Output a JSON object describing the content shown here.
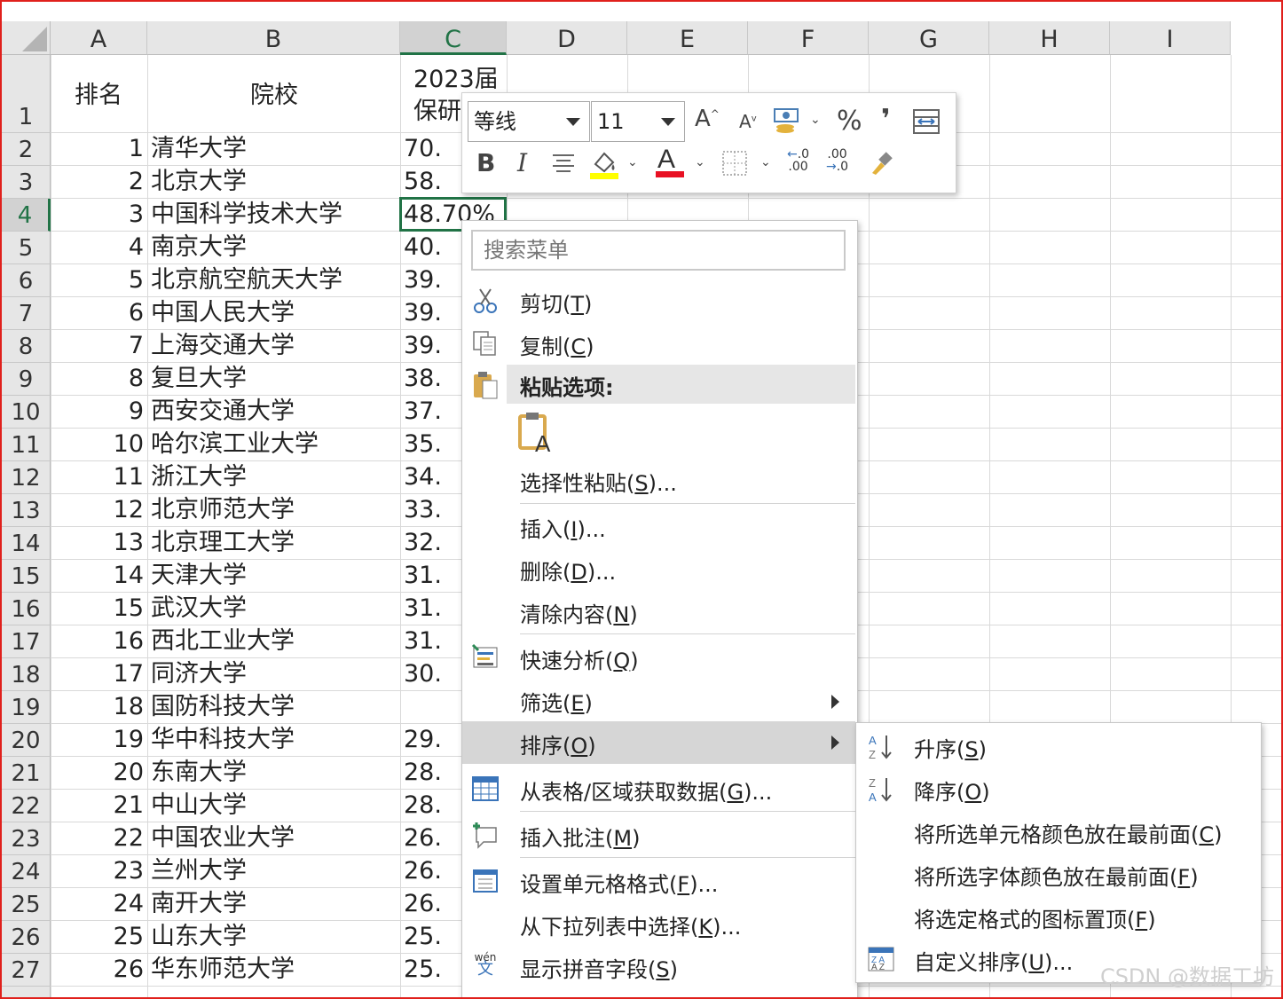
{
  "columns": [
    "A",
    "B",
    "C",
    "D",
    "E",
    "F",
    "G",
    "H",
    "I"
  ],
  "selected_column": "C",
  "selected_row": "4",
  "header_row": {
    "rank": "排名",
    "school": "院校",
    "c_line1": "2023届",
    "c_line2": "保研"
  },
  "rows": [
    {
      "row": "2",
      "rank": "1",
      "school": "清华大学",
      "c": "70."
    },
    {
      "row": "3",
      "rank": "2",
      "school": "北京大学",
      "c": "58."
    },
    {
      "row": "4",
      "rank": "3",
      "school": "中国科学技术大学",
      "c": "48.70%"
    },
    {
      "row": "5",
      "rank": "4",
      "school": "南京大学",
      "c": "40."
    },
    {
      "row": "6",
      "rank": "5",
      "school": "北京航空航天大学",
      "c": "39."
    },
    {
      "row": "7",
      "rank": "6",
      "school": "中国人民大学",
      "c": "39."
    },
    {
      "row": "8",
      "rank": "7",
      "school": "上海交通大学",
      "c": "39."
    },
    {
      "row": "9",
      "rank": "8",
      "school": "复旦大学",
      "c": "38."
    },
    {
      "row": "10",
      "rank": "9",
      "school": "西安交通大学",
      "c": "37."
    },
    {
      "row": "11",
      "rank": "10",
      "school": "哈尔滨工业大学",
      "c": "35."
    },
    {
      "row": "12",
      "rank": "11",
      "school": "浙江大学",
      "c": "34."
    },
    {
      "row": "13",
      "rank": "12",
      "school": "北京师范大学",
      "c": "33."
    },
    {
      "row": "14",
      "rank": "13",
      "school": "北京理工大学",
      "c": "32."
    },
    {
      "row": "15",
      "rank": "14",
      "school": "天津大学",
      "c": "31."
    },
    {
      "row": "16",
      "rank": "15",
      "school": "武汉大学",
      "c": "31."
    },
    {
      "row": "17",
      "rank": "16",
      "school": "西北工业大学",
      "c": "31."
    },
    {
      "row": "18",
      "rank": "17",
      "school": "同济大学",
      "c": "30."
    },
    {
      "row": "19",
      "rank": "18",
      "school": "国防科技大学",
      "c": ""
    },
    {
      "row": "20",
      "rank": "19",
      "school": "华中科技大学",
      "c": "29."
    },
    {
      "row": "21",
      "rank": "20",
      "school": "东南大学",
      "c": "28."
    },
    {
      "row": "22",
      "rank": "21",
      "school": "中山大学",
      "c": "28."
    },
    {
      "row": "23",
      "rank": "22",
      "school": "中国农业大学",
      "c": "26."
    },
    {
      "row": "24",
      "rank": "23",
      "school": "兰州大学",
      "c": "26."
    },
    {
      "row": "25",
      "rank": "24",
      "school": "南开大学",
      "c": "26."
    },
    {
      "row": "26",
      "rank": "25",
      "school": "山东大学",
      "c": "25."
    },
    {
      "row": "27",
      "rank": "26",
      "school": "华东师范大学",
      "c": "25."
    }
  ],
  "mini_toolbar": {
    "font": "等线",
    "size": "11",
    "percent": "%",
    "comma": "❜",
    "bold": "B",
    "italic": "I",
    "font_color": "#e81123",
    "fill_color": "#ffff00"
  },
  "menu": {
    "search_placeholder": "搜索菜单",
    "cut": [
      "剪切(",
      "T",
      ")"
    ],
    "copy": [
      "复制(",
      "C",
      ")"
    ],
    "paste_header": "粘贴选项:",
    "paste_special": [
      "选择性粘贴(",
      "S",
      ")..."
    ],
    "insert": [
      "插入(",
      "I",
      ")..."
    ],
    "delete": [
      "删除(",
      "D",
      ")..."
    ],
    "clear": [
      "清除内容(",
      "N",
      ")"
    ],
    "quick_analysis": [
      "快速分析(",
      "Q",
      ")"
    ],
    "filter": [
      "筛选(",
      "E",
      ")"
    ],
    "sort": [
      "排序(",
      "O",
      ")"
    ],
    "get_data": [
      "从表格/区域获取数据(",
      "G",
      ")..."
    ],
    "insert_comment": [
      "插入批注(",
      "M",
      ")"
    ],
    "format_cells": [
      "设置单元格格式(",
      "F",
      ")..."
    ],
    "pick_list": [
      "从下拉列表中选择(",
      "K",
      ")..."
    ],
    "phonetic": [
      "显示拼音字段(",
      "S",
      ")"
    ]
  },
  "submenu": {
    "asc": [
      "升序(",
      "S",
      ")"
    ],
    "desc": [
      "降序(",
      "O",
      ")"
    ],
    "cell_color": [
      "将所选单元格颜色放在最前面(",
      "C",
      ")"
    ],
    "font_color": [
      "将所选字体颜色放在最前面(",
      "F",
      ")"
    ],
    "icon_top": [
      "将选定格式的图标置顶(",
      "F",
      ")"
    ],
    "custom": [
      "自定义排序(",
      "U",
      ")..."
    ]
  },
  "watermark": "CSDN @数据工坊"
}
